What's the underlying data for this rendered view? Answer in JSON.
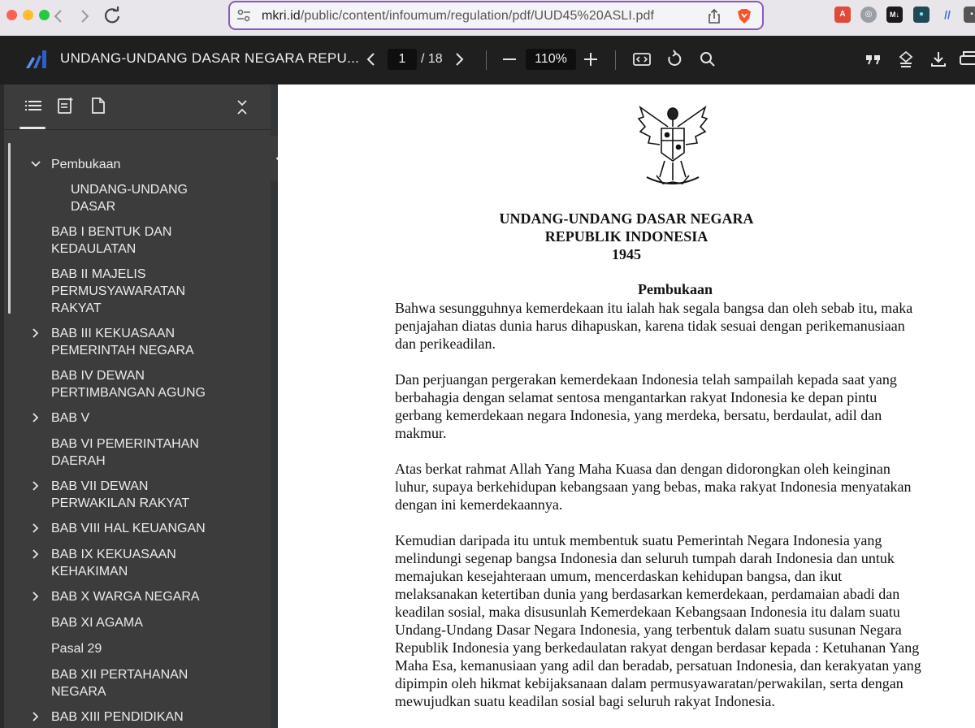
{
  "browser": {
    "url_prefix": "mkri.id",
    "url_rest": "/public/content/infoumum/regulation/pdf/UUD45%20ASLI.pdf"
  },
  "toolbar": {
    "title": "UNDANG-UNDANG DASAR NEGARA REPU...",
    "page_current": "1",
    "page_total": "/ 18",
    "zoom": "110%"
  },
  "sidebar": {
    "outline": [
      {
        "label_lines": [
          "Pembukaan"
        ],
        "expander": "expanded"
      },
      {
        "label_lines": [
          "UNDANG-UNDANG",
          "DASAR"
        ],
        "expander": "none",
        "indent": true
      },
      {
        "label_lines": [
          "BAB I BENTUK DAN",
          "KEDAULATAN"
        ],
        "expander": "none"
      },
      {
        "label_lines": [
          "BAB II MAJELIS",
          "PERMUSYAWARATAN",
          "RAKYAT"
        ],
        "expander": "none"
      },
      {
        "label_lines": [
          "BAB III KEKUASAAN",
          "PEMERINTAH NEGARA"
        ],
        "expander": "collapsed"
      },
      {
        "label_lines": [
          "BAB IV DEWAN",
          "PERTIMBANGAN AGUNG"
        ],
        "expander": "none"
      },
      {
        "label_lines": [
          "BAB V"
        ],
        "expander": "collapsed"
      },
      {
        "label_lines": [
          "BAB VI PEMERINTAHAN",
          "DAERAH"
        ],
        "expander": "none"
      },
      {
        "label_lines": [
          "BAB VII DEWAN",
          "PERWAKILAN RAKYAT"
        ],
        "expander": "collapsed"
      },
      {
        "label_lines": [
          "BAB VIII HAL KEUANGAN"
        ],
        "expander": "collapsed"
      },
      {
        "label_lines": [
          "BAB IX KEKUASAAN",
          "KEHAKIMAN"
        ],
        "expander": "collapsed"
      },
      {
        "label_lines": [
          "BAB X WARGA NEGARA"
        ],
        "expander": "collapsed"
      },
      {
        "label_lines": [
          "BAB XI AGAMA"
        ],
        "expander": "none"
      },
      {
        "label_lines": [
          "Pasal 29"
        ],
        "expander": "none"
      },
      {
        "label_lines": [
          "BAB XII PERTAHANAN",
          "NEGARA"
        ],
        "expander": "none"
      },
      {
        "label_lines": [
          "BAB XIII PENDIDIKAN"
        ],
        "expander": "collapsed"
      }
    ]
  },
  "document": {
    "title_lines": [
      "UNDANG-UNDANG DASAR NEGARA",
      "REPUBLIK INDONESIA",
      "1945"
    ],
    "heading": "Pembukaan",
    "paragraphs": [
      [
        "Bahwa sesungguhnya kemerdekaan itu ialah hak segala bangsa dan oleh sebab itu, maka",
        "penjajahan diatas dunia harus dihapuskan, karena tidak sesuai dengan perikemanusiaan",
        "dan perikeadilan."
      ],
      [
        "Dan perjuangan pergerakan kemerdekaan Indonesia telah sampailah kepada saat yang",
        "berbahagia dengan selamat sentosa mengantarkan rakyat Indonesia ke depan pintu",
        "gerbang kemerdekaan negara Indonesia, yang merdeka, bersatu, berdaulat, adil dan",
        "makmur."
      ],
      [
        "Atas berkat rahmat Allah Yang Maha Kuasa dan dengan didorongkan oleh keinginan",
        "luhur, supaya berkehidupan kebangsaan yang bebas, maka rakyat Indonesia menyatakan",
        "dengan ini kemerdekaannya."
      ],
      [
        "Kemudian daripada itu untuk membentuk suatu Pemerintah Negara Indonesia yang",
        "melindungi segenap bangsa Indonesia dan seluruh tumpah darah Indonesia dan untuk",
        "memajukan kesejahteraan umum, mencerdaskan kehidupan bangsa, dan ikut",
        "melaksanakan ketertiban dunia yang berdasarkan kemerdekaan, perdamaian abadi dan",
        "keadilan sosial, maka disusunlah Kemerdekaan Kebangsaan Indonesia itu dalam suatu",
        "Undang-Undang Dasar Negara Indonesia, yang terbentuk dalam suatu susunan Negara",
        "Republik Indonesia yang berkedaulatan rakyat dengan berdasar kepada : Ketuhanan Yang",
        "Maha Esa, kemanusiaan yang adil dan beradab, persatuan Indonesia, dan kerakyatan yang",
        "dipimpin oleh hikmat kebijaksanaan dalam permusyawaratan/perwakilan, serta dengan",
        "mewujudkan suatu keadilan sosial bagi seluruh rakyat Indonesia."
      ]
    ]
  },
  "colors": {
    "accent": "#8b57c4",
    "toolbar_bg": "#1f1f1f",
    "sidebar_bg": "#3c3c3c"
  }
}
